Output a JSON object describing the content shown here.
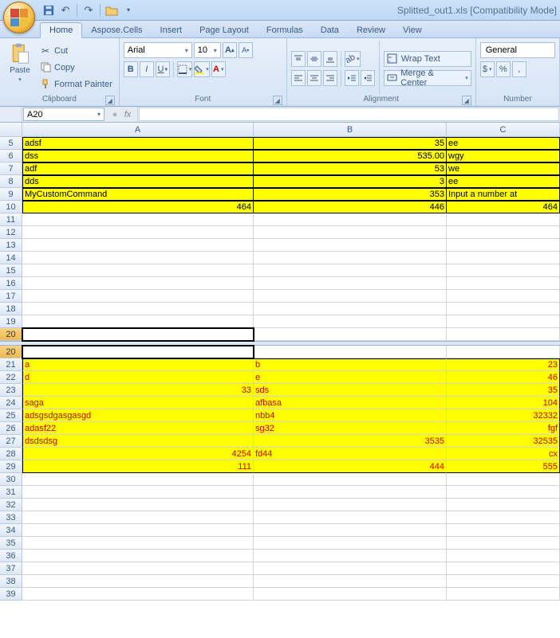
{
  "title": "Splitted_out1.xls  [Compatibility Mode]",
  "qat": {
    "save": "💾",
    "undo": "↶",
    "redo": "↷",
    "open": "📂"
  },
  "tabs": [
    "Home",
    "Aspose.Cells",
    "Insert",
    "Page Layout",
    "Formulas",
    "Data",
    "Review",
    "View"
  ],
  "active_tab": 0,
  "ribbon": {
    "clipboard": {
      "paste": "Paste",
      "cut": "Cut",
      "copy": "Copy",
      "format_painter": "Format Painter",
      "label": "Clipboard"
    },
    "font": {
      "name": "Arial",
      "size": "10",
      "grow": "A",
      "shrink": "A",
      "label": "Font"
    },
    "alignment": {
      "wrap": "Wrap Text",
      "merge": "Merge & Center",
      "label": "Alignment"
    },
    "number": {
      "format": "General",
      "label": "Number"
    }
  },
  "namebox": "A20",
  "fx_label": "fx",
  "columns": [
    "A",
    "B",
    "C"
  ],
  "pane1": {
    "rows": [
      {
        "n": 5,
        "A": "adsf",
        "B": "35",
        "C": "ee",
        "yl": true,
        "b": true,
        "bnum": true
      },
      {
        "n": 6,
        "A": "dss",
        "B": "535.00",
        "C": "wgy",
        "yl": true,
        "b": true,
        "bnum": true
      },
      {
        "n": 7,
        "A": "adf",
        "B": "53",
        "C": "we",
        "yl": true,
        "b": true,
        "bnum": true
      },
      {
        "n": 8,
        "A": "dds",
        "B": "3",
        "C": "ee",
        "yl": true,
        "b": true,
        "bnum": true
      },
      {
        "n": 9,
        "A": "MyCustomCommand",
        "B": "353",
        "C": "Input a number at",
        "yl": true,
        "b": true,
        "bnum": true
      },
      {
        "n": 10,
        "A": "464",
        "B": "446",
        "C": "464",
        "yl": true,
        "b": true,
        "anum": true,
        "bnum": true,
        "cnum": true
      },
      {
        "n": 11
      },
      {
        "n": 12
      },
      {
        "n": 13
      },
      {
        "n": 14
      },
      {
        "n": 15
      },
      {
        "n": 16
      },
      {
        "n": 17
      },
      {
        "n": 18
      },
      {
        "n": 19
      },
      {
        "n": 20,
        "sel": true
      }
    ]
  },
  "pane2": {
    "rows": [
      {
        "n": 20,
        "sel": true
      },
      {
        "n": 21,
        "A": "a",
        "B": "b",
        "C": "23",
        "yl": true,
        "red": true,
        "cnum": true,
        "topb": true
      },
      {
        "n": 22,
        "A": "d",
        "B": "e",
        "C": "46",
        "yl": true,
        "red": true,
        "cnum": true
      },
      {
        "n": 23,
        "A": "33",
        "B": "sds",
        "C": "35",
        "yl": true,
        "red": true,
        "anum": true,
        "cnum": true
      },
      {
        "n": 24,
        "A": "saga",
        "B": "afbasa",
        "C": "104",
        "yl": true,
        "red": true,
        "cnum": true
      },
      {
        "n": 25,
        "A": "adsgsdgasgasgd",
        "B": "nbb4",
        "C": "32332",
        "yl": true,
        "red": true,
        "cnum": true
      },
      {
        "n": 26,
        "A": "adasf22",
        "B": "sg32",
        "C": "fgf",
        "yl": true,
        "red": true,
        "cnum": true
      },
      {
        "n": 27,
        "A": "dsdsdsg",
        "B": "3535",
        "C": "32535",
        "yl": true,
        "red": true,
        "bnum": true,
        "cnum": true
      },
      {
        "n": 28,
        "A": "4254",
        "B": "fd44",
        "C": "cx",
        "yl": true,
        "red": true,
        "anum": true,
        "cnum": true
      },
      {
        "n": 29,
        "A": "111",
        "B": "444",
        "C": "555",
        "yl": true,
        "red": true,
        "anum": true,
        "bnum": true,
        "cnum": true,
        "botb": true
      },
      {
        "n": 30
      },
      {
        "n": 31
      },
      {
        "n": 32
      },
      {
        "n": 33
      },
      {
        "n": 34
      },
      {
        "n": 35
      },
      {
        "n": 36
      },
      {
        "n": 37
      },
      {
        "n": 38
      },
      {
        "n": 39
      }
    ]
  }
}
